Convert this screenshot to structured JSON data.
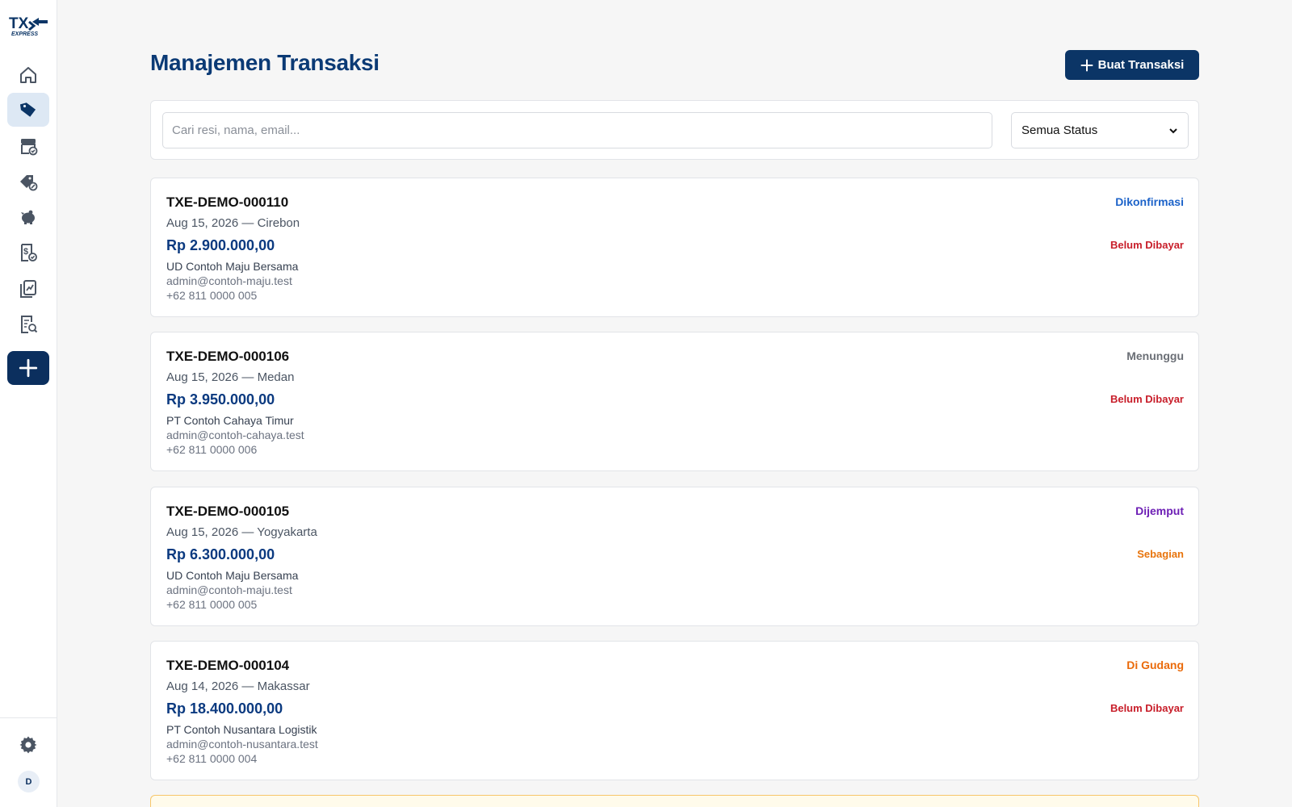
{
  "app": {
    "logo_text": "TXE EXPRESS"
  },
  "sidebar": {
    "items": [
      {
        "name": "home-icon"
      },
      {
        "name": "tag-icon",
        "active": true
      },
      {
        "name": "archive-check-icon"
      },
      {
        "name": "discount-icon"
      },
      {
        "name": "piggy-bank-icon"
      },
      {
        "name": "receipt-check-icon"
      },
      {
        "name": "reports-icon"
      },
      {
        "name": "audit-search-icon"
      }
    ],
    "avatar_initial": "D"
  },
  "header": {
    "title": "Manajemen Transaksi",
    "create_label": "Buat Transaksi"
  },
  "filters": {
    "search_placeholder": "Cari resi, nama, email...",
    "status_selected": "Semua Status"
  },
  "transactions": [
    {
      "resi": "TXE-DEMO-000110",
      "meta": "Aug 15, 2026 — Cirebon",
      "amount": "Rp 2.900.000,00",
      "company": "UD Contoh Maju Bersama",
      "email": "admin@contoh-maju.test",
      "phone": "+62 811 0000 005",
      "status": "Dikonfirmasi",
      "status_color": "#1d63c9",
      "payment": "Belum Dibayar",
      "payment_color": "#c81e2a"
    },
    {
      "resi": "TXE-DEMO-000106",
      "meta": "Aug 15, 2026 — Medan",
      "amount": "Rp 3.950.000,00",
      "company": "PT Contoh Cahaya Timur",
      "email": "admin@contoh-cahaya.test",
      "phone": "+62 811 0000 006",
      "status": "Menunggu",
      "status_color": "#6b6f76",
      "payment": "Belum Dibayar",
      "payment_color": "#c81e2a"
    },
    {
      "resi": "TXE-DEMO-000105",
      "meta": "Aug 15, 2026 — Yogyakarta",
      "amount": "Rp 6.300.000,00",
      "company": "UD Contoh Maju Bersama",
      "email": "admin@contoh-maju.test",
      "phone": "+62 811 0000 005",
      "status": "Dijemput",
      "status_color": "#6d1fb5",
      "payment": "Sebagian",
      "payment_color": "#e8740c"
    },
    {
      "resi": "TXE-DEMO-000104",
      "meta": "Aug 14, 2026 — Makassar",
      "amount": "Rp 18.400.000,00",
      "company": "PT Contoh Nusantara Logistik",
      "email": "admin@contoh-nusantara.test",
      "phone": "+62 811 0000 004",
      "status": "Di Gudang",
      "status_color": "#ea6a0a",
      "payment": "Belum Dibayar",
      "payment_color": "#c81e2a"
    }
  ],
  "colors": {
    "primary": "#0b3566",
    "title": "#0b3a75",
    "amount": "#0b3a80",
    "sidebar_active_bg": "#dde8f4",
    "partial_card_border": "#f7c66a"
  }
}
